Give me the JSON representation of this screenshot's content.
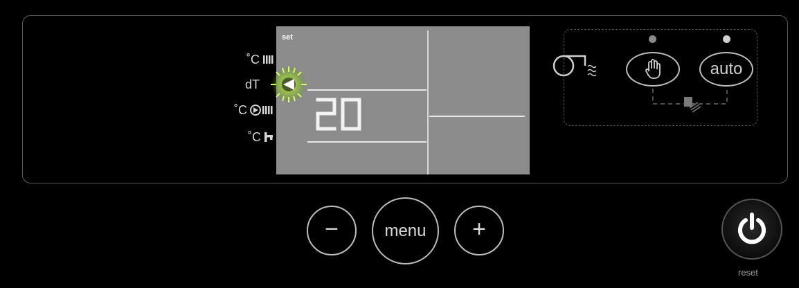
{
  "side_labels": {
    "row1_unit": "˚C",
    "row2_label": "dT",
    "row3_unit": "˚C",
    "row4_unit": "˚C"
  },
  "lcd": {
    "set_label": "set",
    "value": "20"
  },
  "modes": {
    "manual_icon": "hand-icon",
    "auto_label": "auto"
  },
  "controls": {
    "minus_label": "−",
    "menu_label": "menu",
    "plus_label": "+",
    "reset_label": "reset"
  },
  "colors": {
    "lcd_background": "#8c8c8c",
    "indicator_glow": "#c6ff3a",
    "led": "#9a9a9a"
  }
}
